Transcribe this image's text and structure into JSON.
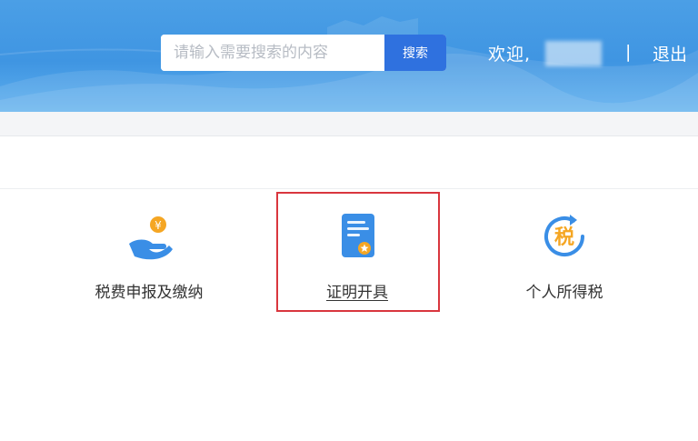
{
  "header": {
    "search": {
      "placeholder": "请输入需要搜索的内容",
      "button_label": "搜索"
    },
    "welcome_text": "欢迎,",
    "separator": "|",
    "logout_label": "退出"
  },
  "services": [
    {
      "label": "税费申报及缴纳",
      "icon": "hand-coin-icon"
    },
    {
      "label": "证明开具",
      "icon": "certificate-icon",
      "highlighted": true
    },
    {
      "label": "个人所得税",
      "icon": "tax-refresh-icon"
    }
  ],
  "colors": {
    "header_blue": "#4b9fe6",
    "search_button": "#2f71df",
    "highlight_border": "#d9363e",
    "icon_blue": "#3a8ee6",
    "icon_orange": "#f5a623"
  }
}
